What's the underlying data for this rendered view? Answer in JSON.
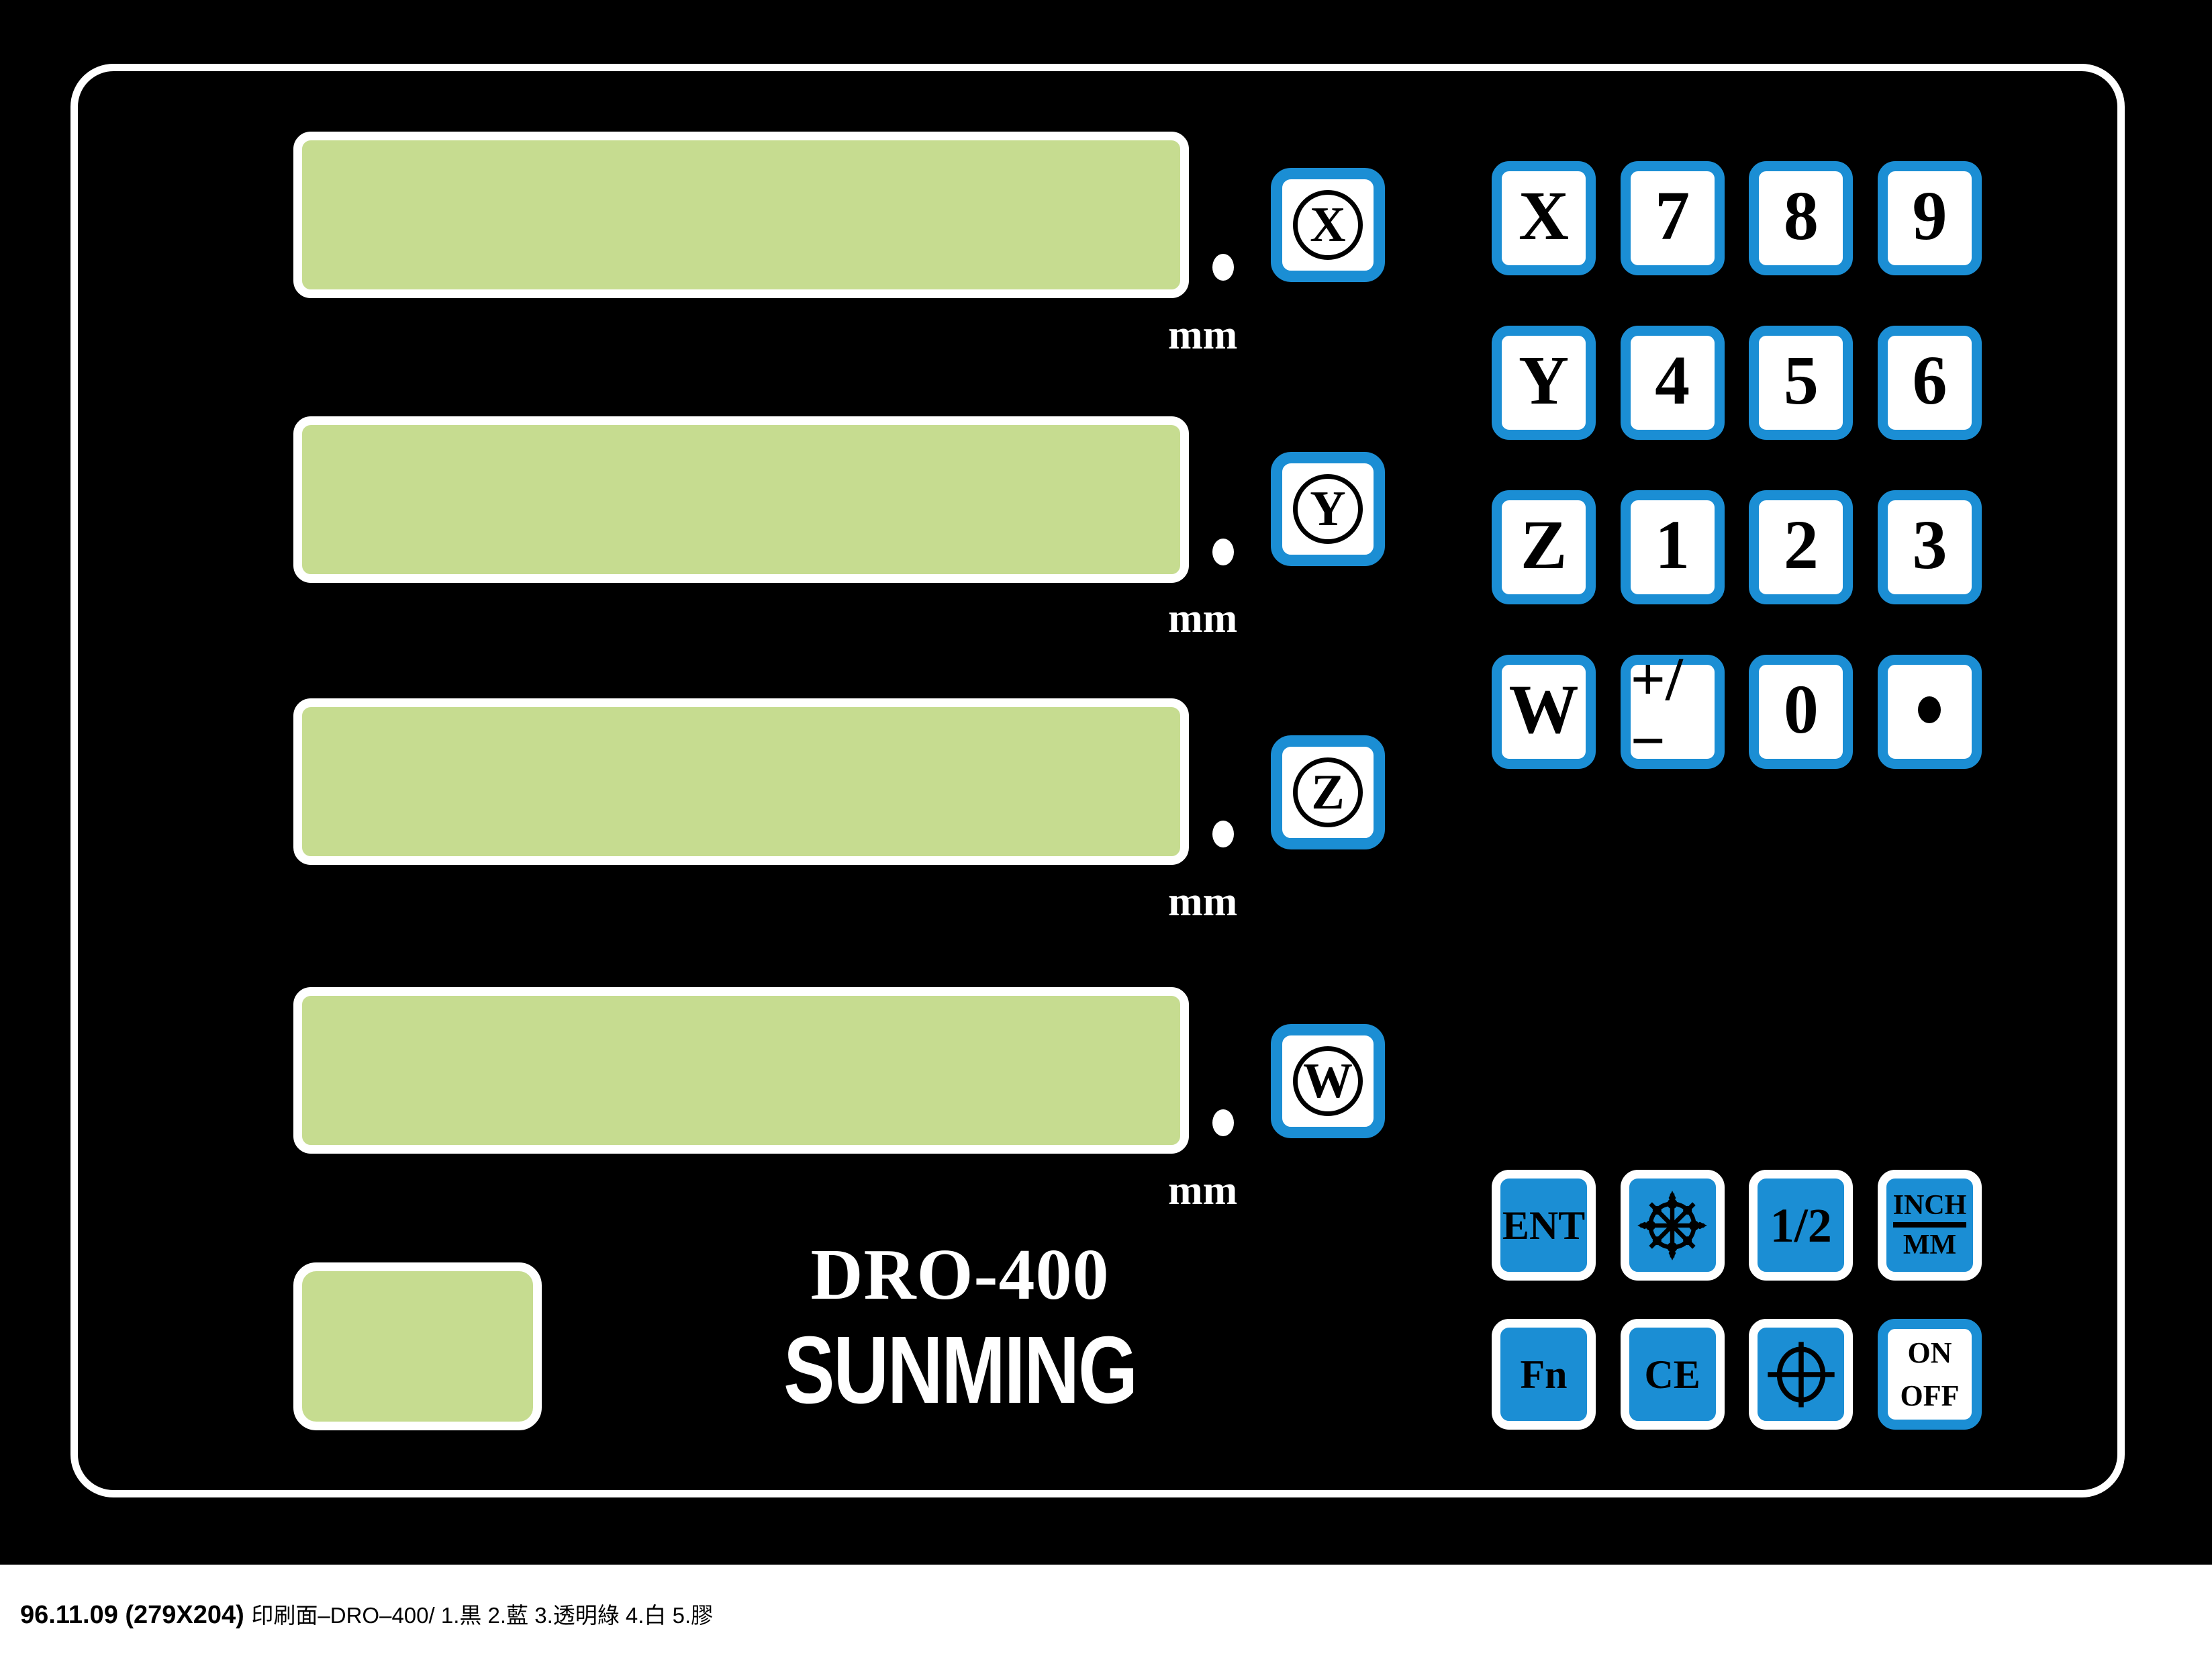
{
  "panel": {
    "brand_model": "DRO-400",
    "brand_name": "SUNMING",
    "background_color": "#000000",
    "frame_color": "#ffffff",
    "accent_blue": "#1b8ed4",
    "display_green": "#c6dc90"
  },
  "displays": [
    {
      "axis": "X",
      "unit_label": "mm",
      "value": ""
    },
    {
      "axis": "Y",
      "unit_label": "mm",
      "value": ""
    },
    {
      "axis": "Z",
      "unit_label": "mm",
      "value": ""
    },
    {
      "axis": "W",
      "unit_label": "mm",
      "value": ""
    }
  ],
  "aux_display": {
    "value": ""
  },
  "axis_keys": [
    {
      "label": "X",
      "icon": "circled-x-icon"
    },
    {
      "label": "Y",
      "icon": "circled-y-icon"
    },
    {
      "label": "Z",
      "icon": "circled-z-icon"
    },
    {
      "label": "W",
      "icon": "circled-w-icon"
    }
  ],
  "numeric_keypad": {
    "rows": [
      [
        {
          "label": "X"
        },
        {
          "label": "7"
        },
        {
          "label": "8"
        },
        {
          "label": "9"
        }
      ],
      [
        {
          "label": "Y"
        },
        {
          "label": "4"
        },
        {
          "label": "5"
        },
        {
          "label": "6"
        }
      ],
      [
        {
          "label": "Z"
        },
        {
          "label": "1"
        },
        {
          "label": "2"
        },
        {
          "label": "3"
        }
      ],
      [
        {
          "label": "W"
        },
        {
          "label": "+/−"
        },
        {
          "label": "0"
        },
        {
          "label": "·"
        }
      ]
    ]
  },
  "function_keypad": {
    "row1": [
      {
        "label": "ENT",
        "type": "text"
      },
      {
        "label": "",
        "type": "icon",
        "icon": "bolt-circle-pattern-icon"
      },
      {
        "label": "1/2",
        "type": "text"
      },
      {
        "label_top": "INCH",
        "label_bottom": "MM",
        "type": "fraction"
      }
    ],
    "row2": [
      {
        "label": "Fn",
        "type": "text"
      },
      {
        "label": "CE",
        "type": "text"
      },
      {
        "label": "",
        "type": "icon",
        "icon": "crosshair-circle-icon"
      },
      {
        "label_top": "ON",
        "label_bottom": "OFF",
        "type": "stack",
        "style": "inverted"
      }
    ]
  },
  "caption": {
    "primary": "96.11.09 (279X204)",
    "secondary": "印刷面–DRO–400/ 1.黒 2.藍 3.透明綠 4.白 5.膠"
  }
}
